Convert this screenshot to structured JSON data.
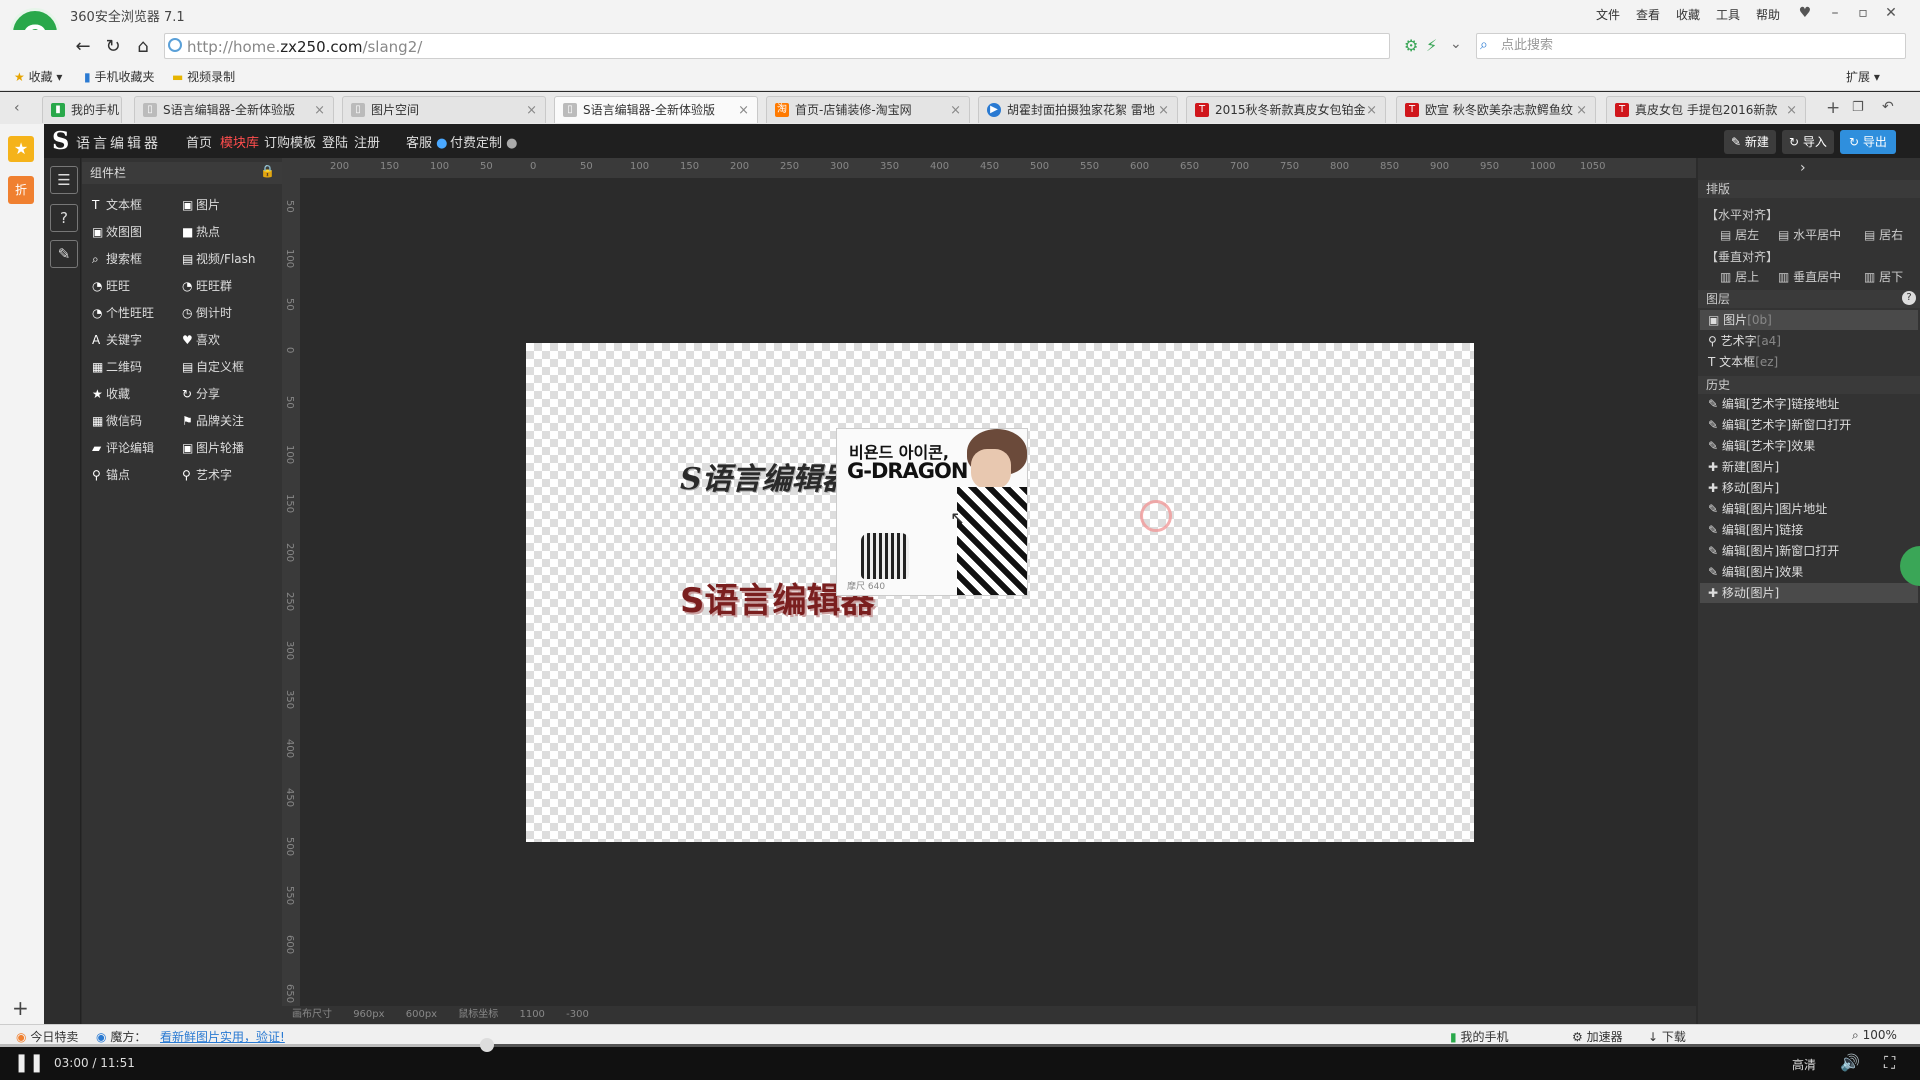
{
  "browser": {
    "app_title": "360安全浏览器 7.1",
    "menu": [
      "文件",
      "查看",
      "收藏",
      "工具",
      "帮助"
    ],
    "url_prefix": "http://home.",
    "url_domain": "zx250.com",
    "url_path": "/slang2/",
    "search_placeholder": "点此搜索",
    "favorites": [
      "收藏",
      "手机收藏夹",
      "视频录制"
    ],
    "extensions_label": "扩展",
    "tabs": [
      {
        "label": "我的手机",
        "active": false
      },
      {
        "label": "S语言编辑器-全新体验版",
        "active": false
      },
      {
        "label": "图片空间",
        "active": false
      },
      {
        "label": "S语言编辑器-全新体验版",
        "active": true
      },
      {
        "label": "首页-店铺装修-淘宝网",
        "active": false
      },
      {
        "label": "胡霍封面拍摄独家花絮 雷地",
        "active": false
      },
      {
        "label": "2015秋冬新款真皮女包铂金",
        "active": false
      },
      {
        "label": "欧宣 秋冬欧美杂志款鳄鱼纹",
        "active": false
      },
      {
        "label": "真皮女包 手提包2016新款",
        "active": false
      }
    ],
    "side_badge": "折"
  },
  "app": {
    "logo": "S",
    "logo_text": "语言编辑器",
    "nav": [
      "首页",
      "模块库",
      "订购模板",
      "登陆",
      "注册"
    ],
    "nav_active_index": 1,
    "service": "客服",
    "custom": "付费定制",
    "buttons": {
      "new": "新建",
      "import": "导入",
      "export": "导出"
    },
    "components_title": "组件栏",
    "components": [
      [
        "文本框",
        "图片"
      ],
      [
        "效图图",
        "热点"
      ],
      [
        "搜索框",
        "视频/Flash"
      ],
      [
        "旺旺",
        "旺旺群"
      ],
      [
        "个性旺旺",
        "倒计时"
      ],
      [
        "关键字",
        "喜欢"
      ],
      [
        "二维码",
        "自定义框"
      ],
      [
        "收藏",
        "分享"
      ],
      [
        "微信码",
        "品牌关注"
      ],
      [
        "评论编辑",
        "图片轮播"
      ],
      [
        "锚点",
        "艺术字"
      ]
    ],
    "ruler_top": [
      "200",
      "150",
      "100",
      "50",
      "0",
      "50",
      "100",
      "150",
      "200",
      "250",
      "300",
      "350",
      "400",
      "450",
      "500",
      "550",
      "600",
      "650",
      "700",
      "750",
      "800",
      "850",
      "900",
      "950",
      "1000",
      "1050"
    ],
    "ruler_left": [
      "50",
      "100",
      "50",
      "0",
      "50",
      "100",
      "150",
      "200",
      "250",
      "300",
      "350",
      "400",
      "450",
      "500",
      "550",
      "600",
      "650"
    ],
    "canvas": {
      "art_text_1": "S语言编辑器",
      "art_text_2": "S语言编辑器",
      "image_caption_ko": "비욘드 아이콘,",
      "image_caption_title": "G-DRAGON",
      "image_footer": "摩尺 640"
    },
    "bottom_info": [
      "画布尺寸",
      "960px",
      "600px",
      "鼠标坐标",
      "1100",
      "-300"
    ],
    "right": {
      "arrange_title": "排版",
      "h_align_title": "【水平对齐】",
      "h_align": [
        "居左",
        "水平居中",
        "居右"
      ],
      "v_align_title": "【垂直对齐】",
      "v_align": [
        "居上",
        "垂直居中",
        "居下"
      ],
      "layers_title": "图层",
      "layers": [
        {
          "label": "图片",
          "tag": "[0b]",
          "icon": "image-icon"
        },
        {
          "label": "艺术字",
          "tag": "[a4]",
          "icon": "pin-icon"
        },
        {
          "label": "文本框",
          "tag": "[ez]",
          "icon": "text-icon"
        }
      ],
      "history_title": "历史",
      "history": [
        {
          "icon": "edit",
          "label": "编辑[艺术字]链接地址"
        },
        {
          "icon": "edit",
          "label": "编辑[艺术字]新窗口打开"
        },
        {
          "icon": "edit",
          "label": "编辑[艺术字]效果"
        },
        {
          "icon": "add",
          "label": "新建[图片]"
        },
        {
          "icon": "add",
          "label": "移动[图片]"
        },
        {
          "icon": "edit",
          "label": "编辑[图片]图片地址"
        },
        {
          "icon": "edit",
          "label": "编辑[图片]链接"
        },
        {
          "icon": "edit",
          "label": "编辑[图片]新窗口打开"
        },
        {
          "icon": "edit",
          "label": "编辑[图片]效果"
        },
        {
          "icon": "add",
          "label": "移动[图片]"
        }
      ]
    }
  },
  "statusbar": {
    "left": [
      "今日特卖",
      "魔方：",
      "看新鲜图片实用，验证!"
    ],
    "right": [
      "我的手机",
      "加速器",
      "下载",
      "100%"
    ]
  },
  "video": {
    "time": "03:00 / 11:51",
    "progress": 0.2535,
    "quality": "高清"
  },
  "colors": {
    "nav_active": "#ff4d4d",
    "export_btn": "#2f8fdd",
    "art_text_2": "#7a1f1f",
    "browser_green": "#29a84a"
  }
}
